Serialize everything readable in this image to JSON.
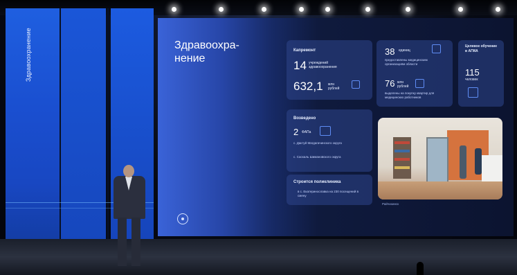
{
  "stage": {
    "vertical_label": "Здравоохранение"
  },
  "slide": {
    "title": "Здравоохра-\nнение",
    "kapremont": {
      "heading": "Капремонт",
      "count": "14",
      "count_label": "учреждений здравоохранения",
      "amount": "632,1",
      "amount_unit": "млн рублей"
    },
    "stat_38": {
      "value": "38",
      "unit": "единиц",
      "desc": "предоставлены медицинским организациям области"
    },
    "stat_76": {
      "value": "76",
      "unit": "млн рублей",
      "desc": "выделены на покупку квартир для медицинских работников"
    },
    "stat_115": {
      "heading": "Целевое обучение в АГМА",
      "value": "115",
      "unit": "человек"
    },
    "built": {
      "heading": "Возведено",
      "count": "2",
      "count_unit": "ФАПа",
      "items": [
        "с. Дактуй Магдагачинского округа",
        "с. Саскаль Шимановского округа"
      ]
    },
    "clinic": {
      "heading": "Строится поликлиника",
      "desc": "в с. Екатеринославка на 230 посещений в смену"
    },
    "photo_caption": "Райчихинск"
  }
}
